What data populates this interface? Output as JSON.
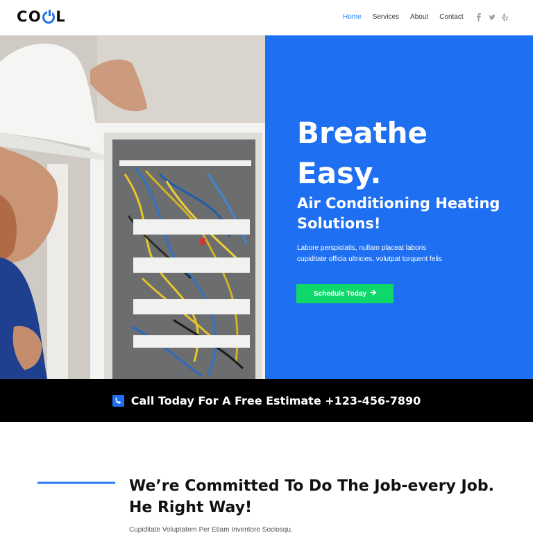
{
  "header": {
    "logo_text_1": "CO",
    "logo_text_2": "L",
    "nav": [
      "Home",
      "Services",
      "About",
      "Contact"
    ],
    "active_nav": "Home",
    "social_icons": [
      "facebook-icon",
      "twitter-icon",
      "yelp-icon"
    ]
  },
  "hero": {
    "title": "Breathe Easy.",
    "subtitle": "Air Conditioning Heating Solutions!",
    "description": "Labore perspiciatis, nullam placeat laboris cupiditate officia ultricies, volutpat torquent felis",
    "cta_label": "Schedule Today",
    "photo_alt": "electrician-working-on-panel-photo"
  },
  "callbar": {
    "text": "Call Today For A Free Estimate +123-456-7890"
  },
  "commitment": {
    "title": "We’re Committed To Do The Job-every Job. He Right Way!",
    "subtitle": "Cupiditate Voluptatem Per Etiam Inventore Sociosqu."
  },
  "colors": {
    "brand_blue": "#1e6ff1",
    "cta_green": "#0fd86a",
    "callbar_bg": "#000000",
    "nav_active": "#2f7bff"
  }
}
